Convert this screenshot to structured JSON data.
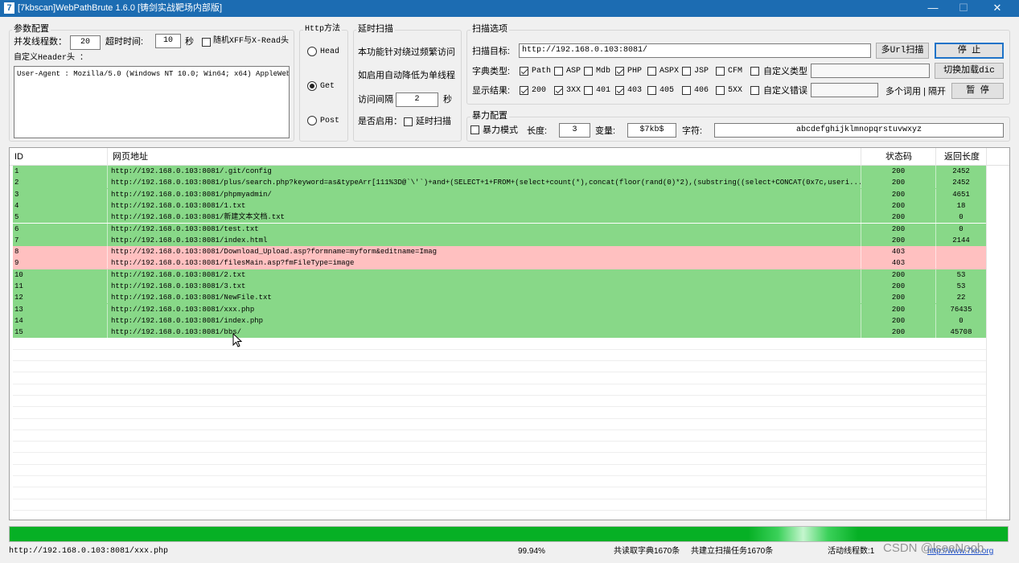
{
  "window": {
    "title": "[7kbscan]WebPathBrute 1.6.0 [铸剑实战靶场内部版]",
    "icon_char": "7",
    "minimize": "—",
    "maximize": "☐",
    "close": "✕"
  },
  "params": {
    "group_title": "参数配置",
    "threads_label": "并发线程数：",
    "threads_value": "20",
    "timeout_label": "超时时间:",
    "timeout_value": "10",
    "timeout_unit": "秒",
    "random_xff_label": "随机XFF与X-Read头",
    "header_label": "自定义Header头 ：",
    "header_value": "User-Agent : Mozilla/5.0 (Windows NT 10.0; Win64; x64) AppleWebKit"
  },
  "http": {
    "group_title": "Http方法",
    "head": "Head",
    "get": "Get",
    "post": "Post",
    "selected": "Get"
  },
  "delay": {
    "group_title": "延时扫描",
    "desc1": "本功能针对绕过频繁访问",
    "desc2": "如启用自动降低为单线程",
    "interval_label": "访问间隔",
    "interval_value": "2",
    "interval_unit": "秒",
    "enable_label": "是否启用：",
    "enable_check": "延时扫描"
  },
  "scan": {
    "group_title": "扫描选项",
    "target_label": "扫描目标:",
    "target_value": "http://192.168.0.103:8081/",
    "multi_url_button": "多Url扫描",
    "stop_button": "停 止",
    "dict_label": "字典类型:",
    "dict_types": [
      {
        "label": "Path",
        "checked": true
      },
      {
        "label": "ASP",
        "checked": false
      },
      {
        "label": "Mdb",
        "checked": false
      },
      {
        "label": "PHP",
        "checked": true
      },
      {
        "label": "ASPX",
        "checked": false
      },
      {
        "label": "JSP",
        "checked": false
      },
      {
        "label": "CFM",
        "checked": false
      },
      {
        "label": "自定义类型",
        "checked": false
      }
    ],
    "switch_dict_button": "切换加载dic",
    "results_label": "显示结果:",
    "result_codes": [
      {
        "label": "200",
        "checked": true
      },
      {
        "label": "3XX",
        "checked": true
      },
      {
        "label": "401",
        "checked": false
      },
      {
        "label": "403",
        "checked": true
      },
      {
        "label": "405",
        "checked": false
      },
      {
        "label": "406",
        "checked": false
      },
      {
        "label": "5XX",
        "checked": false
      },
      {
        "label": "自定义错误",
        "checked": false
      }
    ],
    "multi_words_label": "多个词用 | 隔开",
    "pause_button": "暂 停"
  },
  "brute": {
    "group_title": "暴力配置",
    "mode_label": "暴力模式",
    "length_label": "长度:",
    "length_value": "3",
    "variable_label": "变量:",
    "variable_value": "$7kb$",
    "chars_label": "字符:",
    "chars_value": "abcdefghijklmnopqrstuvwxyz"
  },
  "table": {
    "columns": [
      "ID",
      "网页地址",
      "状态码",
      "返回长度"
    ],
    "rows": [
      {
        "id": "1",
        "url": "http://192.168.0.103:8081/.git/config",
        "status": "200",
        "length": "2452",
        "color": "green"
      },
      {
        "id": "2",
        "url": "http://192.168.0.103:8081/plus/search.php?keyword=as&typeArr[111%3D@`\\'`)+and+(SELECT+1+FROM+(select+count(*),concat(floor(rand(0)*2),(substring((select+CONCAT(0x7c,useri...",
        "status": "200",
        "length": "2452",
        "color": "green"
      },
      {
        "id": "3",
        "url": "http://192.168.0.103:8081/phpmyadmin/",
        "status": "200",
        "length": "4651",
        "color": "green"
      },
      {
        "id": "4",
        "url": "http://192.168.0.103:8081/1.txt",
        "status": "200",
        "length": "18",
        "color": "green"
      },
      {
        "id": "5",
        "url": "http://192.168.0.103:8081/新建文本文档.txt",
        "status": "200",
        "length": "0",
        "color": "green"
      },
      {
        "id": "6",
        "url": "http://192.168.0.103:8081/test.txt",
        "status": "200",
        "length": "0",
        "color": "green"
      },
      {
        "id": "7",
        "url": "http://192.168.0.103:8081/index.html",
        "status": "200",
        "length": "2144",
        "color": "green"
      },
      {
        "id": "8",
        "url": "http://192.168.0.103:8081/Download_Upload.asp?formname=myform&editname=Imag",
        "status": "403",
        "length": "",
        "color": "red"
      },
      {
        "id": "9",
        "url": "http://192.168.0.103:8081/filesMain.asp?fmFileType=image",
        "status": "403",
        "length": "",
        "color": "red"
      },
      {
        "id": "10",
        "url": "http://192.168.0.103:8081/2.txt",
        "status": "200",
        "length": "53",
        "color": "green"
      },
      {
        "id": "11",
        "url": "http://192.168.0.103:8081/3.txt",
        "status": "200",
        "length": "53",
        "color": "green"
      },
      {
        "id": "12",
        "url": "http://192.168.0.103:8081/NewFile.txt",
        "status": "200",
        "length": "22",
        "color": "green"
      },
      {
        "id": "13",
        "url": "http://192.168.0.103:8081/xxx.php",
        "status": "200",
        "length": "76435",
        "color": "green"
      },
      {
        "id": "14",
        "url": "http://192.168.0.103:8081/index.php",
        "status": "200",
        "length": "0",
        "color": "green"
      },
      {
        "id": "15",
        "url": "http://192.168.0.103:8081/bbs/",
        "status": "200",
        "length": "45708",
        "color": "green"
      }
    ]
  },
  "progress": {
    "value": 0.9994,
    "color": "#06b025"
  },
  "statusbar": {
    "current_url": "http://192.168.0.103:8081/xxx.php",
    "percent": "99.94%",
    "dict_read": "共读取字典1670条",
    "tasks": "共建立扫描任务1670条",
    "active_threads": "活动线程数:1",
    "link": "http://www.7kb.org"
  },
  "watermark": "CSDN @lseeNoob",
  "colors": {
    "titlebar": "#1c6cb2",
    "row_green": "#88d888",
    "row_red": "#ffc0c0",
    "focus_border": "#1e73c8"
  }
}
